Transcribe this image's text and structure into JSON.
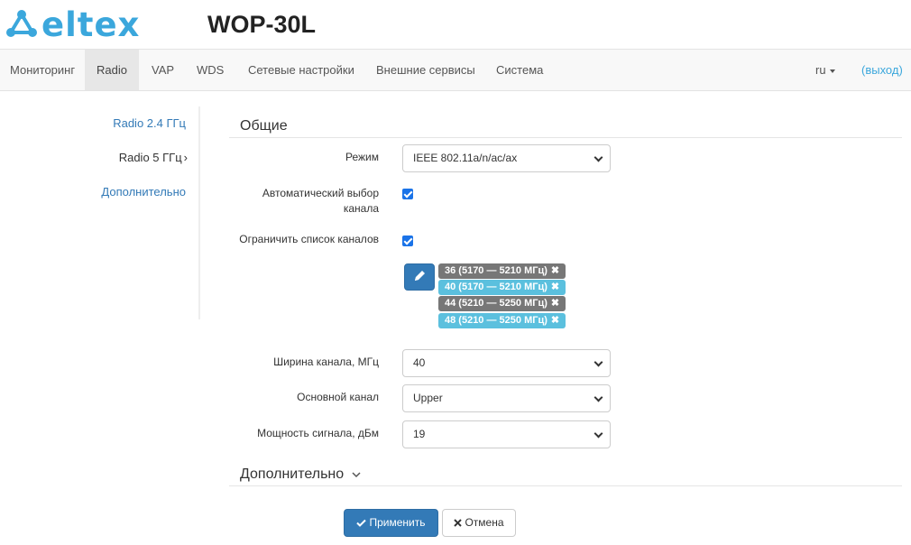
{
  "header": {
    "logo_text": "eltex",
    "device_title": "WOP-30L"
  },
  "nav": {
    "items": [
      {
        "label": "Мониторинг"
      },
      {
        "label": "Radio"
      },
      {
        "label": "VAP"
      },
      {
        "label": "WDS"
      },
      {
        "label": "Сетевые настройки"
      },
      {
        "label": "Внешние сервисы"
      },
      {
        "label": "Система"
      }
    ],
    "active": "Radio",
    "language": "ru",
    "logout": "(выход)"
  },
  "sidebar": {
    "items": [
      {
        "label": "Radio 2.4 ГГц"
      },
      {
        "label": "Radio 5 ГГц"
      },
      {
        "label": "Дополнительно"
      }
    ],
    "current": "Radio 5 ГГц"
  },
  "main": {
    "section_general": "Общие",
    "mode": {
      "label": "Режим",
      "value": "IEEE 802.11a/n/ac/ax"
    },
    "auto_channel": {
      "label_line1": "Автоматический выбор",
      "label_line2": "канала",
      "checked": true
    },
    "limit_channels": {
      "label": "Ограничить список каналов",
      "checked": true
    },
    "channels": [
      {
        "text": "36 (5170 — 5210 МГц)",
        "color": "#777777"
      },
      {
        "text": "40 (5170 — 5210 МГц)",
        "color": "#5bc0de"
      },
      {
        "text": "44 (5210 — 5250 МГц)",
        "color": "#777777"
      },
      {
        "text": "48 (5210 — 5250 МГц)",
        "color": "#5bc0de"
      }
    ],
    "bandwidth": {
      "label": "Ширина канала, МГц",
      "value": "40"
    },
    "primary_channel": {
      "label": "Основной канал",
      "value": "Upper"
    },
    "tx_power": {
      "label": "Мощность сигнала, дБм",
      "value": "19"
    },
    "section_advanced": "Дополнительно"
  },
  "buttons": {
    "apply": "Применить",
    "cancel": "Отмена"
  },
  "colors": {
    "brand": "#3ba7dc",
    "primary": "#337ab7",
    "checkbox": "#1a73e8"
  }
}
